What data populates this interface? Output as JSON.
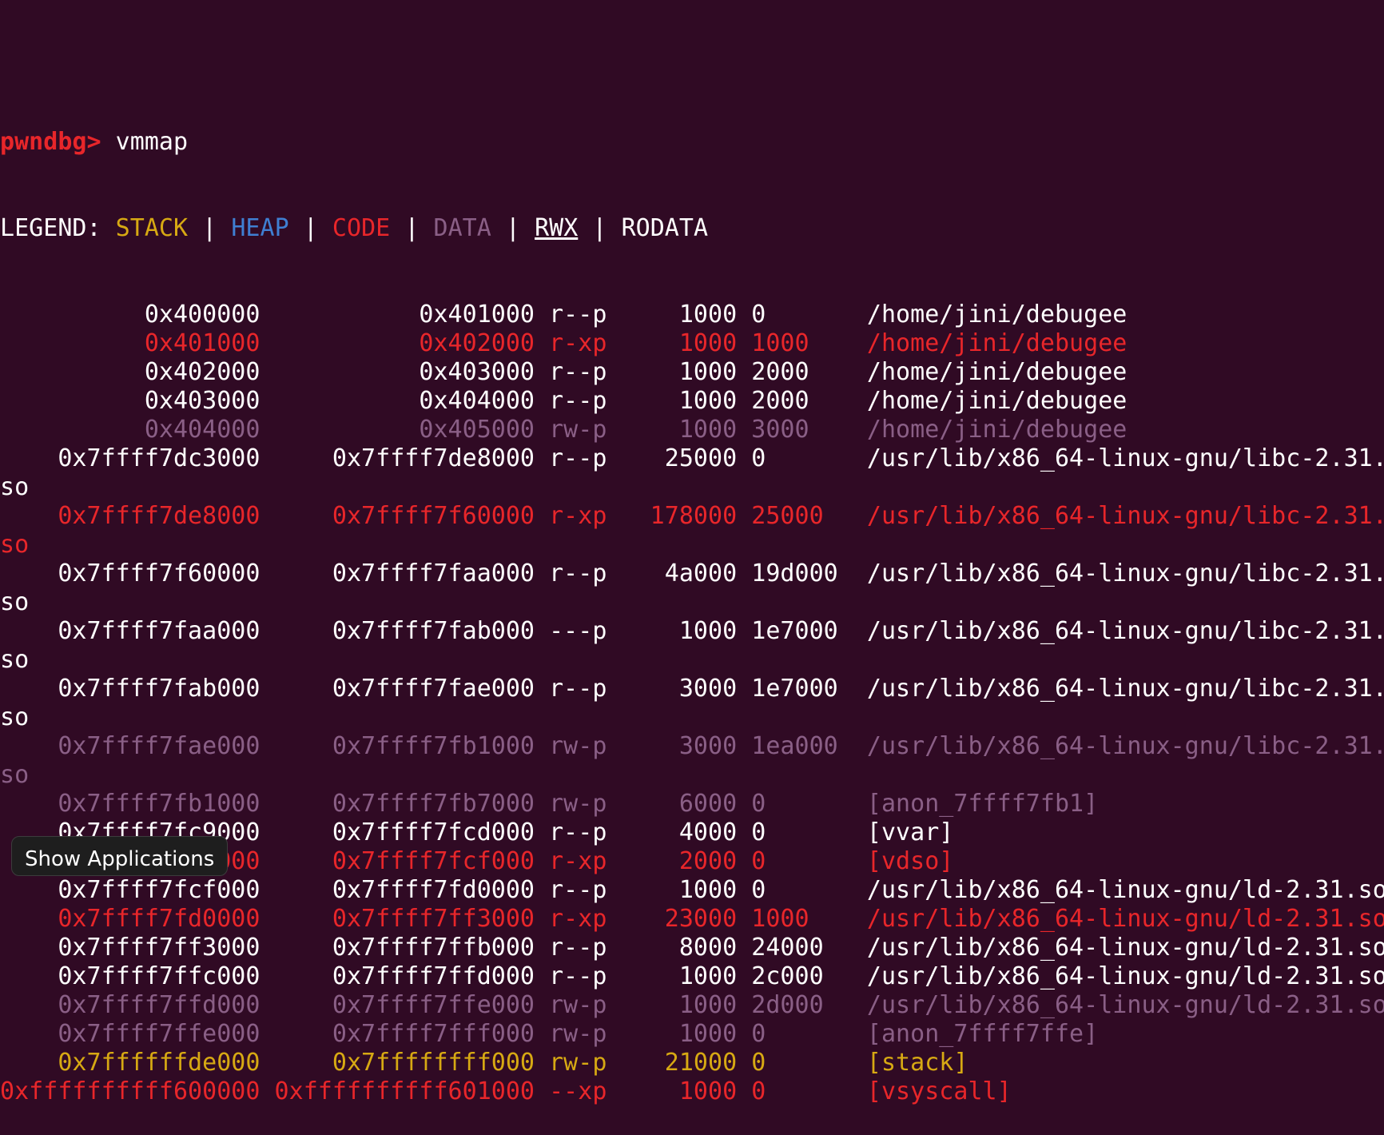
{
  "prompt": {
    "label": "pwndbg>",
    "command": "vmmap"
  },
  "legend": {
    "prefix": "LEGEND: ",
    "stack": "STACK",
    "heap": "HEAP",
    "code": "CODE",
    "data": "DATA",
    "rwx": "RWX",
    "rodata": "RODATA",
    "separator": " | "
  },
  "colors": {
    "background": "#300a24",
    "default": "#ffffff",
    "code": "#e8262a",
    "data": "#8a5f86",
    "stack": "#d7a913",
    "heap": "#3f7fd2"
  },
  "mappings": [
    {
      "start": "0x400000",
      "end": "0x401000",
      "perm": "r--p",
      "size": "1000",
      "offset": "0",
      "path": "/home/jini/debugee",
      "kind": "rodata"
    },
    {
      "start": "0x401000",
      "end": "0x402000",
      "perm": "r-xp",
      "size": "1000",
      "offset": "1000",
      "path": "/home/jini/debugee",
      "kind": "code"
    },
    {
      "start": "0x402000",
      "end": "0x403000",
      "perm": "r--p",
      "size": "1000",
      "offset": "2000",
      "path": "/home/jini/debugee",
      "kind": "rodata"
    },
    {
      "start": "0x403000",
      "end": "0x404000",
      "perm": "r--p",
      "size": "1000",
      "offset": "2000",
      "path": "/home/jini/debugee",
      "kind": "rodata"
    },
    {
      "start": "0x404000",
      "end": "0x405000",
      "perm": "rw-p",
      "size": "1000",
      "offset": "3000",
      "path": "/home/jini/debugee",
      "kind": "data"
    },
    {
      "start": "0x7ffff7dc3000",
      "end": "0x7ffff7de8000",
      "perm": "r--p",
      "size": "25000",
      "offset": "0",
      "path": "/usr/lib/x86_64-linux-gnu/libc-2.31.so",
      "kind": "rodata"
    },
    {
      "start": "0x7ffff7de8000",
      "end": "0x7ffff7f60000",
      "perm": "r-xp",
      "size": "178000",
      "offset": "25000",
      "path": "/usr/lib/x86_64-linux-gnu/libc-2.31.so",
      "kind": "code"
    },
    {
      "start": "0x7ffff7f60000",
      "end": "0x7ffff7faa000",
      "perm": "r--p",
      "size": "4a000",
      "offset": "19d000",
      "path": "/usr/lib/x86_64-linux-gnu/libc-2.31.so",
      "kind": "rodata"
    },
    {
      "start": "0x7ffff7faa000",
      "end": "0x7ffff7fab000",
      "perm": "---p",
      "size": "1000",
      "offset": "1e7000",
      "path": "/usr/lib/x86_64-linux-gnu/libc-2.31.so",
      "kind": "rodata"
    },
    {
      "start": "0x7ffff7fab000",
      "end": "0x7ffff7fae000",
      "perm": "r--p",
      "size": "3000",
      "offset": "1e7000",
      "path": "/usr/lib/x86_64-linux-gnu/libc-2.31.so",
      "kind": "rodata"
    },
    {
      "start": "0x7ffff7fae000",
      "end": "0x7ffff7fb1000",
      "perm": "rw-p",
      "size": "3000",
      "offset": "1ea000",
      "path": "/usr/lib/x86_64-linux-gnu/libc-2.31.so",
      "kind": "data"
    },
    {
      "start": "0x7ffff7fb1000",
      "end": "0x7ffff7fb7000",
      "perm": "rw-p",
      "size": "6000",
      "offset": "0",
      "path": "[anon_7ffff7fb1]",
      "kind": "data"
    },
    {
      "start": "0x7ffff7fc9000",
      "end": "0x7ffff7fcd000",
      "perm": "r--p",
      "size": "4000",
      "offset": "0",
      "path": "[vvar]",
      "kind": "rodata"
    },
    {
      "start": "0x7ffff7fcd000",
      "end": "0x7ffff7fcf000",
      "perm": "r-xp",
      "size": "2000",
      "offset": "0",
      "path": "[vdso]",
      "kind": "code"
    },
    {
      "start": "0x7ffff7fcf000",
      "end": "0x7ffff7fd0000",
      "perm": "r--p",
      "size": "1000",
      "offset": "0",
      "path": "/usr/lib/x86_64-linux-gnu/ld-2.31.so",
      "kind": "rodata"
    },
    {
      "start": "0x7ffff7fd0000",
      "end": "0x7ffff7ff3000",
      "perm": "r-xp",
      "size": "23000",
      "offset": "1000",
      "path": "/usr/lib/x86_64-linux-gnu/ld-2.31.so",
      "kind": "code"
    },
    {
      "start": "0x7ffff7ff3000",
      "end": "0x7ffff7ffb000",
      "perm": "r--p",
      "size": "8000",
      "offset": "24000",
      "path": "/usr/lib/x86_64-linux-gnu/ld-2.31.so",
      "kind": "rodata"
    },
    {
      "start": "0x7ffff7ffc000",
      "end": "0x7ffff7ffd000",
      "perm": "r--p",
      "size": "1000",
      "offset": "2c000",
      "path": "/usr/lib/x86_64-linux-gnu/ld-2.31.so",
      "kind": "rodata"
    },
    {
      "start": "0x7ffff7ffd000",
      "end": "0x7ffff7ffe000",
      "perm": "rw-p",
      "size": "1000",
      "offset": "2d000",
      "path": "/usr/lib/x86_64-linux-gnu/ld-2.31.so",
      "kind": "data"
    },
    {
      "start": "0x7ffff7ffe000",
      "end": "0x7ffff7fff000",
      "perm": "rw-p",
      "size": "1000",
      "offset": "0",
      "path": "[anon_7ffff7ffe]",
      "kind": "data"
    },
    {
      "start": "0x7ffffffde000",
      "end": "0x7ffffffff000",
      "perm": "rw-p",
      "size": "21000",
      "offset": "0",
      "path": "[stack]",
      "kind": "stack"
    },
    {
      "start": "0xffffffffff600000",
      "end": "0xffffffffff601000",
      "perm": "--xp",
      "size": "1000",
      "offset": "0",
      "path": "[vsyscall]",
      "kind": "code"
    }
  ],
  "taskbar": {
    "show_applications": "Show Applications"
  }
}
